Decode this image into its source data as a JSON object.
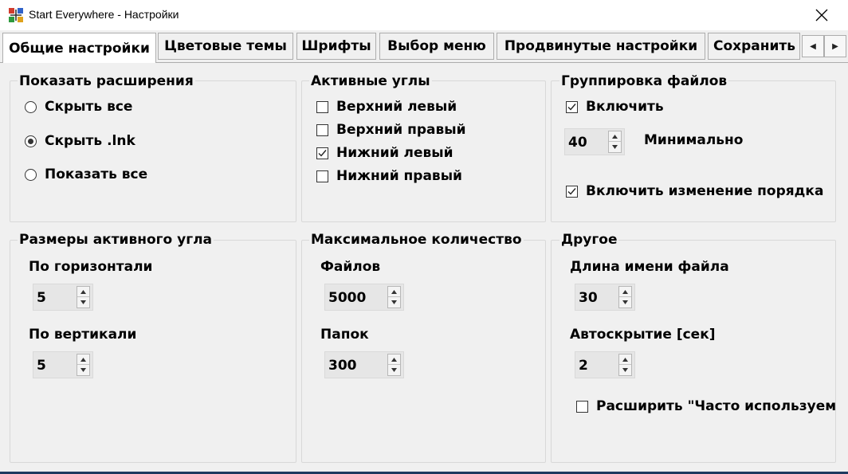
{
  "window": {
    "title": "Start Everywhere - Настройки",
    "icon": "app-icon"
  },
  "tabs": [
    {
      "label": "Общие настройки",
      "active": true
    },
    {
      "label": "Цветовые темы"
    },
    {
      "label": "Шрифты"
    },
    {
      "label": "Выбор меню"
    },
    {
      "label": "Продвинутые настройки"
    },
    {
      "label": "Сохранить"
    }
  ],
  "show_extensions": {
    "title": "Показать расширения",
    "options": [
      {
        "label": "Скрыть все",
        "selected": false
      },
      {
        "label": "Скрыть .lnk",
        "selected": true
      },
      {
        "label": "Показать все",
        "selected": false
      }
    ]
  },
  "active_corners": {
    "title": "Активные углы",
    "items": [
      {
        "label": "Верхний левый",
        "checked": false
      },
      {
        "label": "Верхний правый",
        "checked": false
      },
      {
        "label": "Нижний левый",
        "checked": true
      },
      {
        "label": "Нижний правый",
        "checked": false
      }
    ]
  },
  "file_grouping": {
    "title": "Группировка файлов",
    "enable_label": "Включить",
    "enable_checked": true,
    "minimum_value": "40",
    "minimum_label": "Минимально",
    "reorder_label": "Включить изменение порядка",
    "reorder_checked": true
  },
  "corner_size": {
    "title": "Размеры активного угла",
    "horizontal_label": "По горизонтали",
    "horizontal_value": "5",
    "vertical_label": "По вертикали",
    "vertical_value": "5"
  },
  "max_count": {
    "title": "Максимальное количество",
    "files_label": "Файлов",
    "files_value": "5000",
    "folders_label": "Папок",
    "folders_value": "300"
  },
  "other": {
    "title": "Другое",
    "filename_length_label": "Длина имени файла",
    "filename_length_value": "30",
    "autohide_label": "Автоскрытие [сек]",
    "autohide_value": "2",
    "expand_label": "Расширить \"Часто используем",
    "expand_checked": false
  }
}
